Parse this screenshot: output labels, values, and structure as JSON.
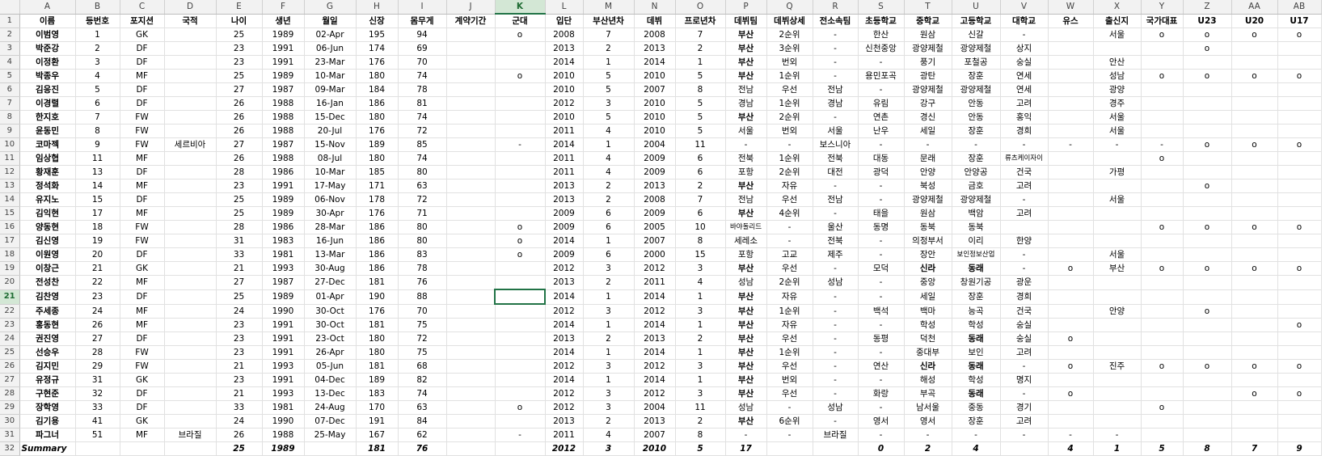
{
  "selection": {
    "column": "K",
    "row": "21"
  },
  "column_letters": [
    "A",
    "B",
    "C",
    "D",
    "E",
    "F",
    "G",
    "H",
    "I",
    "J",
    "K",
    "L",
    "M",
    "N",
    "O",
    "P",
    "Q",
    "R",
    "S",
    "T",
    "U",
    "V",
    "W",
    "X",
    "Y",
    "Z",
    "AA",
    "AB"
  ],
  "headers": [
    "이름",
    "등번호",
    "포지션",
    "국적",
    "나이",
    "생년",
    "월일",
    "신장",
    "몸무게",
    "계약기간",
    "군대",
    "입단",
    "부산년차",
    "데뷔",
    "프로년차",
    "데뷔팀",
    "데뷔상세",
    "전소속팀",
    "초등학교",
    "중학교",
    "고등학교",
    "대학교",
    "유스",
    "출신지",
    "국가대표",
    "U23",
    "U20",
    "U17"
  ],
  "rows": [
    [
      "이범영",
      "1",
      "GK",
      "",
      "25",
      "1989",
      "02-Apr",
      "195",
      "94",
      "",
      "o",
      "2008",
      "7",
      "2008",
      "7",
      "부산",
      "2순위",
      "-",
      "한산",
      "원삼",
      "신갈",
      "-",
      "",
      "서울",
      "o",
      "o",
      "o",
      "o"
    ],
    [
      "박준강",
      "2",
      "DF",
      "",
      "23",
      "1991",
      "06-Jun",
      "174",
      "69",
      "",
      "",
      "2013",
      "2",
      "2013",
      "2",
      "부산",
      "3순위",
      "-",
      "신천중앙",
      "광양제철",
      "광양제철",
      "상지",
      "",
      "",
      "",
      "o",
      "",
      ""
    ],
    [
      "이정환",
      "3",
      "DF",
      "",
      "23",
      "1991",
      "23-Mar",
      "176",
      "70",
      "",
      "",
      "2014",
      "1",
      "2014",
      "1",
      "부산",
      "번외",
      "-",
      "-",
      "풍기",
      "포철공",
      "숭실",
      "",
      "안산",
      "",
      "",
      "",
      ""
    ],
    [
      "박종우",
      "4",
      "MF",
      "",
      "25",
      "1989",
      "10-Mar",
      "180",
      "74",
      "",
      "o",
      "2010",
      "5",
      "2010",
      "5",
      "부산",
      "1순위",
      "-",
      "용민포곡",
      "광탄",
      "장훈",
      "연세",
      "",
      "성남",
      "o",
      "o",
      "o",
      "o"
    ],
    [
      "김응진",
      "5",
      "DF",
      "",
      "27",
      "1987",
      "09-Mar",
      "184",
      "78",
      "",
      "",
      "2010",
      "5",
      "2007",
      "8",
      "전남",
      "우선",
      "전남",
      "-",
      "광양제철",
      "광양제철",
      "연세",
      "",
      "광양",
      "",
      "",
      "",
      ""
    ],
    [
      "이경렬",
      "6",
      "DF",
      "",
      "26",
      "1988",
      "16-Jan",
      "186",
      "81",
      "",
      "",
      "2012",
      "3",
      "2010",
      "5",
      "경남",
      "1순위",
      "경남",
      "유림",
      "강구",
      "안동",
      "고려",
      "",
      "경주",
      "",
      "",
      "",
      ""
    ],
    [
      "한지호",
      "7",
      "FW",
      "",
      "26",
      "1988",
      "15-Dec",
      "180",
      "74",
      "",
      "",
      "2010",
      "5",
      "2010",
      "5",
      "부산",
      "2순위",
      "-",
      "연촌",
      "경신",
      "안동",
      "홍익",
      "",
      "서울",
      "",
      "",
      "",
      ""
    ],
    [
      "윤동민",
      "8",
      "FW",
      "",
      "26",
      "1988",
      "20-Jul",
      "176",
      "72",
      "",
      "",
      "2011",
      "4",
      "2010",
      "5",
      "서울",
      "번외",
      "서울",
      "난우",
      "세일",
      "장훈",
      "경희",
      "",
      "서울",
      "",
      "",
      "",
      ""
    ],
    [
      "코마젝",
      "9",
      "FW",
      "세르비아",
      "27",
      "1987",
      "15-Nov",
      "189",
      "85",
      "",
      "-",
      "2014",
      "1",
      "2004",
      "11",
      "-",
      "-",
      "보스니아",
      "-",
      "-",
      "-",
      "-",
      "-",
      "-",
      "-",
      "o",
      "o",
      "o"
    ],
    [
      "임상협",
      "11",
      "MF",
      "",
      "26",
      "1988",
      "08-Jul",
      "180",
      "74",
      "",
      "",
      "2011",
      "4",
      "2009",
      "6",
      "전북",
      "1순위",
      "전북",
      "대동",
      "문래",
      "장훈",
      "류츠케이자이",
      "",
      "",
      "o",
      "",
      "",
      ""
    ],
    [
      "황재훈",
      "13",
      "DF",
      "",
      "28",
      "1986",
      "10-Mar",
      "185",
      "80",
      "",
      "",
      "2011",
      "4",
      "2009",
      "6",
      "포항",
      "2순위",
      "대전",
      "광덕",
      "안양",
      "안양공",
      "건국",
      "",
      "가평",
      "",
      "",
      "",
      ""
    ],
    [
      "정석화",
      "14",
      "MF",
      "",
      "23",
      "1991",
      "17-May",
      "171",
      "63",
      "",
      "",
      "2013",
      "2",
      "2013",
      "2",
      "부산",
      "자유",
      "-",
      "-",
      "북성",
      "금호",
      "고려",
      "",
      "",
      "",
      "o",
      "",
      ""
    ],
    [
      "유지노",
      "15",
      "DF",
      "",
      "25",
      "1989",
      "06-Nov",
      "178",
      "72",
      "",
      "",
      "2013",
      "2",
      "2008",
      "7",
      "전남",
      "우선",
      "전남",
      "-",
      "광양제철",
      "광양제철",
      "-",
      "",
      "서울",
      "",
      "",
      "",
      ""
    ],
    [
      "김익현",
      "17",
      "MF",
      "",
      "25",
      "1989",
      "30-Apr",
      "176",
      "71",
      "",
      "",
      "2009",
      "6",
      "2009",
      "6",
      "부산",
      "4순위",
      "-",
      "태을",
      "원삼",
      "백암",
      "고려",
      "",
      "",
      "",
      "",
      "",
      ""
    ],
    [
      "양동현",
      "18",
      "FW",
      "",
      "28",
      "1986",
      "28-Mar",
      "186",
      "80",
      "",
      "o",
      "2009",
      "6",
      "2005",
      "10",
      "바야돌리드",
      "-",
      "울산",
      "동명",
      "동북",
      "동북",
      "",
      "",
      "",
      "o",
      "o",
      "o",
      "o"
    ],
    [
      "김신영",
      "19",
      "FW",
      "",
      "31",
      "1983",
      "16-Jun",
      "186",
      "80",
      "",
      "o",
      "2014",
      "1",
      "2007",
      "8",
      "세레소",
      "-",
      "전북",
      "-",
      "의정부서",
      "이리",
      "한양",
      "",
      "",
      "",
      "",
      "",
      ""
    ],
    [
      "이원영",
      "20",
      "DF",
      "",
      "33",
      "1981",
      "13-Mar",
      "186",
      "83",
      "",
      "o",
      "2009",
      "6",
      "2000",
      "15",
      "포항",
      "고교",
      "제주",
      "-",
      "장안",
      "보인정보산업",
      "-",
      "",
      "서울",
      "",
      "",
      "",
      ""
    ],
    [
      "이창근",
      "21",
      "GK",
      "",
      "21",
      "1993",
      "30-Aug",
      "186",
      "78",
      "",
      "",
      "2012",
      "3",
      "2012",
      "3",
      "부산",
      "우선",
      "-",
      "모덕",
      "신라",
      "동래",
      "-",
      "o",
      "부산",
      "o",
      "o",
      "o",
      "o"
    ],
    [
      "전성찬",
      "22",
      "MF",
      "",
      "27",
      "1987",
      "27-Dec",
      "181",
      "76",
      "",
      "",
      "2013",
      "2",
      "2011",
      "4",
      "성남",
      "2순위",
      "성남",
      "-",
      "중앙",
      "창원기공",
      "광운",
      "",
      "",
      "",
      "",
      "",
      ""
    ],
    [
      "김찬영",
      "23",
      "DF",
      "",
      "25",
      "1989",
      "01-Apr",
      "190",
      "88",
      "",
      "",
      "2014",
      "1",
      "2014",
      "1",
      "부산",
      "자유",
      "-",
      "-",
      "세일",
      "장훈",
      "경희",
      "",
      "",
      "",
      "",
      "",
      ""
    ],
    [
      "주세종",
      "24",
      "MF",
      "",
      "24",
      "1990",
      "30-Oct",
      "176",
      "70",
      "",
      "",
      "2012",
      "3",
      "2012",
      "3",
      "부산",
      "1순위",
      "-",
      "백석",
      "백마",
      "능곡",
      "건국",
      "",
      "안양",
      "",
      "o",
      "",
      ""
    ],
    [
      "홍동현",
      "26",
      "MF",
      "",
      "23",
      "1991",
      "30-Oct",
      "181",
      "75",
      "",
      "",
      "2014",
      "1",
      "2014",
      "1",
      "부산",
      "자유",
      "-",
      "-",
      "학성",
      "학성",
      "숭실",
      "",
      "",
      "",
      "",
      "",
      "o"
    ],
    [
      "권진영",
      "27",
      "DF",
      "",
      "23",
      "1991",
      "23-Oct",
      "180",
      "72",
      "",
      "",
      "2013",
      "2",
      "2013",
      "2",
      "부산",
      "우선",
      "-",
      "동평",
      "덕천",
      "동래",
      "숭실",
      "o",
      "",
      "",
      "",
      "",
      ""
    ],
    [
      "선승우",
      "28",
      "FW",
      "",
      "23",
      "1991",
      "26-Apr",
      "180",
      "75",
      "",
      "",
      "2014",
      "1",
      "2014",
      "1",
      "부산",
      "1순위",
      "-",
      "-",
      "중대부",
      "보인",
      "고려",
      "",
      "",
      "",
      "",
      "",
      ""
    ],
    [
      "김지민",
      "29",
      "FW",
      "",
      "21",
      "1993",
      "05-Jun",
      "181",
      "68",
      "",
      "",
      "2012",
      "3",
      "2012",
      "3",
      "부산",
      "우선",
      "-",
      "연산",
      "신라",
      "동래",
      "-",
      "o",
      "진주",
      "o",
      "o",
      "o",
      "o"
    ],
    [
      "유정규",
      "31",
      "GK",
      "",
      "23",
      "1991",
      "04-Dec",
      "189",
      "82",
      "",
      "",
      "2014",
      "1",
      "2014",
      "1",
      "부산",
      "번외",
      "-",
      "-",
      "해성",
      "학성",
      "명지",
      "",
      "",
      "",
      "",
      "",
      ""
    ],
    [
      "구현준",
      "32",
      "DF",
      "",
      "21",
      "1993",
      "13-Dec",
      "183",
      "74",
      "",
      "",
      "2012",
      "3",
      "2012",
      "3",
      "부산",
      "우선",
      "-",
      "화랑",
      "부곡",
      "동래",
      "-",
      "o",
      "",
      "",
      "",
      "o",
      "o"
    ],
    [
      "장학영",
      "33",
      "DF",
      "",
      "33",
      "1981",
      "24-Aug",
      "170",
      "63",
      "",
      "o",
      "2012",
      "3",
      "2004",
      "11",
      "성남",
      "-",
      "성남",
      "-",
      "남서울",
      "중동",
      "경기",
      "",
      "",
      "o",
      "",
      "",
      ""
    ],
    [
      "김기용",
      "41",
      "GK",
      "",
      "24",
      "1990",
      "07-Dec",
      "191",
      "84",
      "",
      "",
      "2013",
      "2",
      "2013",
      "2",
      "부산",
      "6순위",
      "-",
      "영서",
      "영서",
      "장훈",
      "고려",
      "",
      "",
      "",
      "",
      "",
      ""
    ],
    [
      "파그너",
      "51",
      "MF",
      "브라질",
      "26",
      "1988",
      "25-May",
      "167",
      "62",
      "",
      "-",
      "2011",
      "4",
      "2007",
      "8",
      "-",
      "-",
      "브라질",
      "-",
      "-",
      "-",
      "-",
      "-",
      "-",
      "",
      "",
      "",
      ""
    ]
  ],
  "summary": [
    "Summary",
    "",
    "",
    "",
    "25",
    "1989",
    "",
    "181",
    "76",
    "",
    "",
    "2012",
    "3",
    "2010",
    "5",
    "17",
    "",
    "",
    "0",
    "2",
    "4",
    "",
    "4",
    "1",
    "5",
    "8",
    "7",
    "9"
  ]
}
